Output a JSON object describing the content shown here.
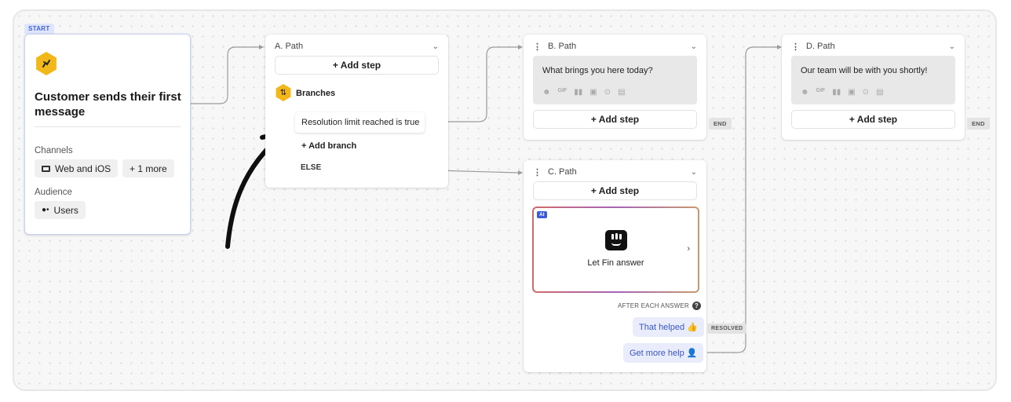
{
  "start": {
    "tag": "START",
    "title": "Customer sends their first message",
    "channels_label": "Channels",
    "channel_chip": "Web and iOS",
    "more_chip": "+ 1 more",
    "audience_label": "Audience",
    "audience_chip": "Users"
  },
  "path_a": {
    "title": "A. Path",
    "add_step": "+ Add step",
    "branches_label": "Branches",
    "condition": "Resolution limit reached is true",
    "add_branch": "+ Add branch",
    "else_label": "ELSE"
  },
  "path_b": {
    "title": "B. Path",
    "message": "What brings you here today?",
    "add_step": "+ Add step",
    "end_tag": "END"
  },
  "path_c": {
    "title": "C. Path",
    "add_step": "+ Add step",
    "ai_badge": "AI",
    "fin_label": "Let Fin answer",
    "after_label": "AFTER EACH ANSWER",
    "reply_helped": "That helped 👍",
    "reply_more_help": "Get more help 👤",
    "resolved_tag": "RESOLVED"
  },
  "path_d": {
    "title": "D. Path",
    "message": "Our team will be with you shortly!",
    "add_step": "+ Add step",
    "end_tag": "END"
  },
  "colors": {
    "start_border": "#c8d3f5",
    "hex_yellow": "#f2b81a",
    "reply_bg": "#e9edfb",
    "reply_text": "#3b55c8",
    "wire": "#9a9a9a"
  },
  "icons": [
    "hand-wave-icon",
    "branches-icon",
    "web-ios-icon",
    "users-icon",
    "emoji-icon",
    "gif-icon",
    "article-icon",
    "image-icon",
    "attachment-icon",
    "app-icon",
    "fin-logo-icon",
    "chevron-down-icon",
    "chevron-right-icon",
    "drag-handle-icon",
    "question-icon",
    "annotation-arrow"
  ]
}
